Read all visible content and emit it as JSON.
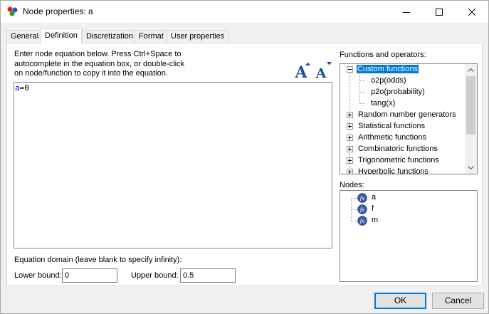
{
  "window": {
    "title": "Node properties: a"
  },
  "tabs": [
    {
      "label": "General",
      "active": false
    },
    {
      "label": "Definition",
      "active": true
    },
    {
      "label": "Discretization",
      "active": false
    },
    {
      "label": "Format",
      "active": false
    },
    {
      "label": "User properties",
      "active": false
    }
  ],
  "definition": {
    "instructions": "Enter node equation below. Press Ctrl+Space to autocomplete in the equation box, or double-click on node/function to copy it into the equation.",
    "equation_var": "a",
    "equation_rest": "=0",
    "domain_label": "Equation domain (leave blank to specify infinity):",
    "lower_bound_label": "Lower bound:",
    "lower_bound_value": "0",
    "upper_bound_label": "Upper bound:",
    "upper_bound_value": "0.5"
  },
  "functions": {
    "label": "Functions and operators:",
    "custom": {
      "label": "Custom functions",
      "children": [
        "o2p(odds)",
        "p2o(probability)",
        "tang(x)"
      ]
    },
    "groups": [
      "Random number generators",
      "Statistical functions",
      "Arithmetic functions",
      "Combinatoric functions",
      "Trigonometric functions",
      "Hyperbolic functions"
    ]
  },
  "nodes": {
    "label": "Nodes:",
    "items": [
      "a",
      "f",
      "m"
    ]
  },
  "buttons": {
    "ok": "OK",
    "cancel": "Cancel"
  },
  "colors": {
    "accent": "#0078d7",
    "keyword": "#0000ff",
    "node_icon": "#3a5fa8"
  }
}
